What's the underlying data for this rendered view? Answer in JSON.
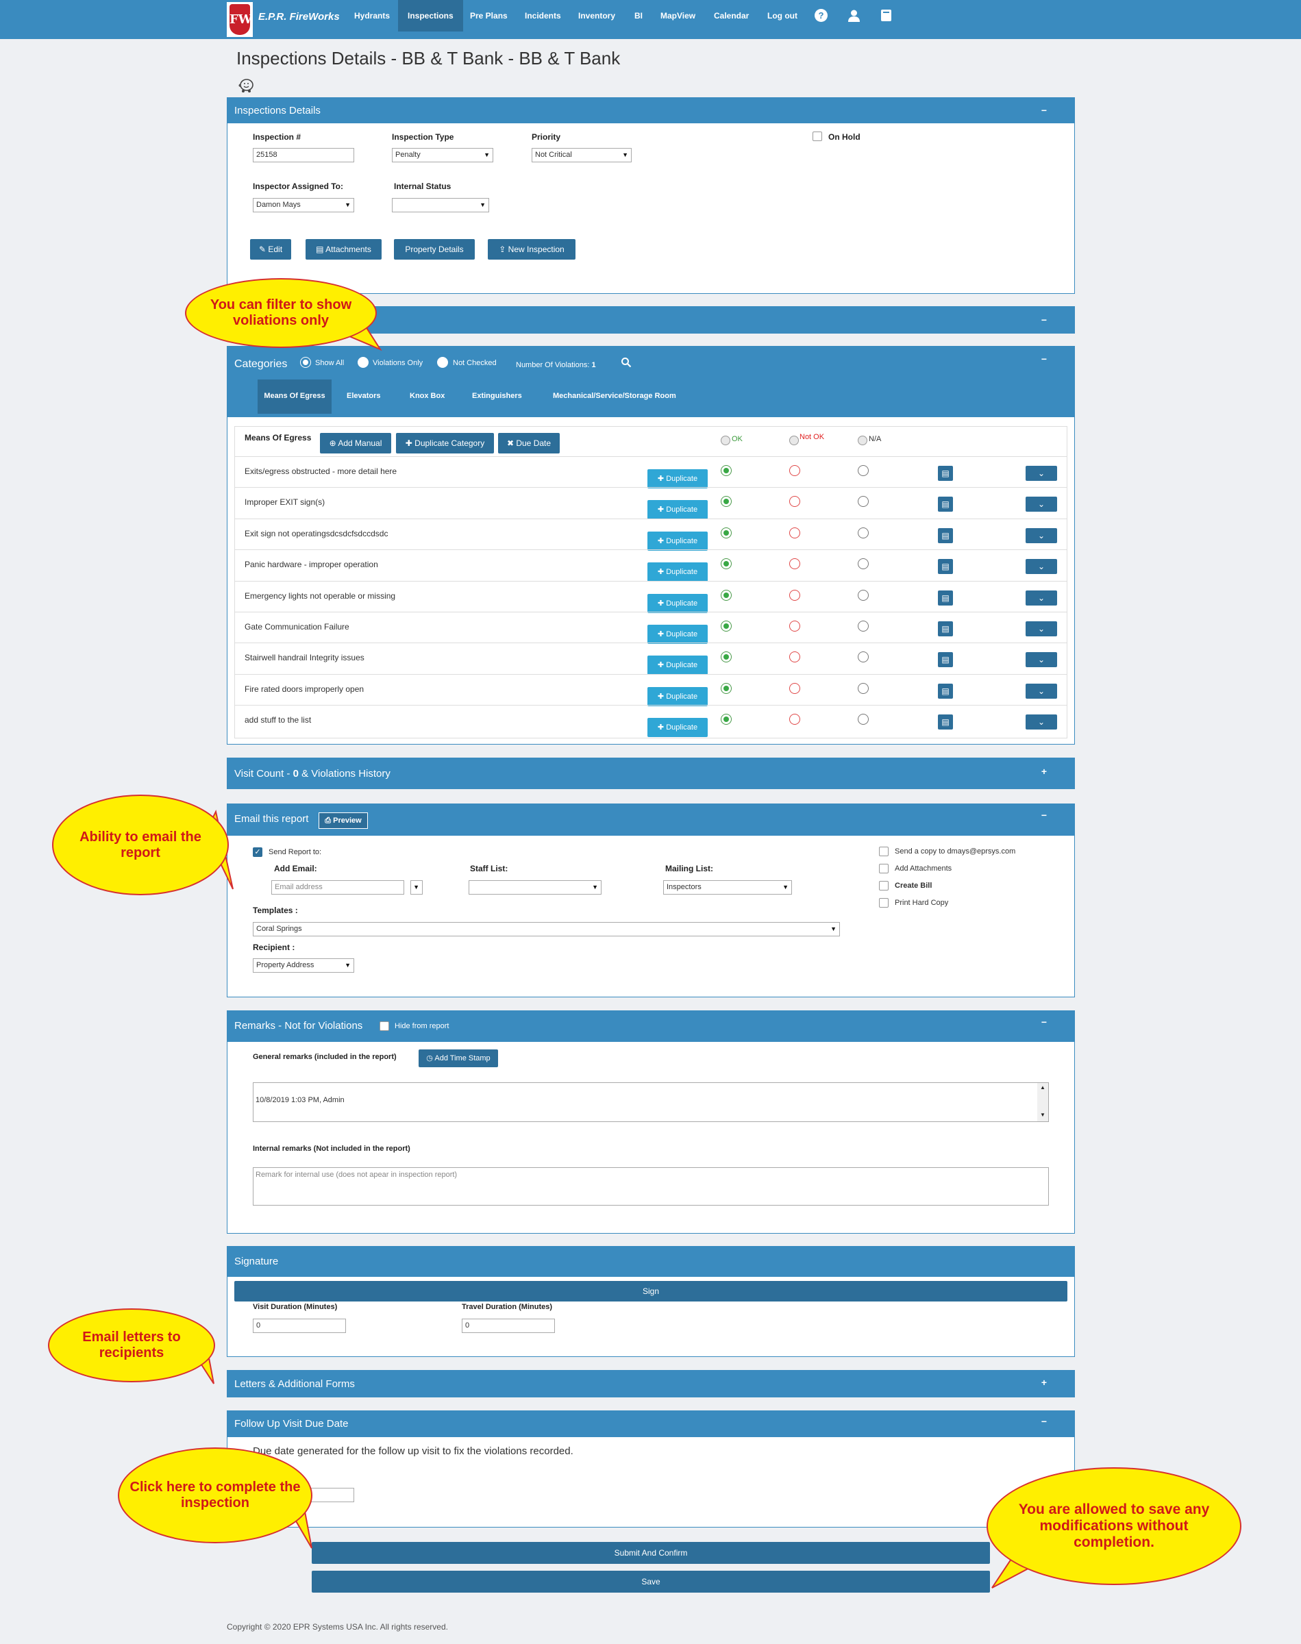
{
  "nav": {
    "brand": "E.P.R. FireWorks",
    "logo_letters": "FW",
    "items": [
      "Hydrants",
      "Inspections",
      "Pre Plans",
      "Incidents",
      "Inventory",
      "BI",
      "MapView",
      "Calendar",
      "Log out"
    ]
  },
  "page_title": "Inspections Details - BB & T Bank - BB & T Bank",
  "details": {
    "title": "Inspections Details",
    "inspection_label": "Inspection #",
    "inspection_value": "25158",
    "type_label": "Inspection Type",
    "type_value": "Penalty",
    "priority_label": "Priority",
    "priority_value": "Not Critical",
    "onhold_label": "On Hold",
    "inspector_label": "Inspector Assigned To:",
    "inspector_value": "Damon Mays",
    "status_label": "Internal Status",
    "buttons": [
      "Edit",
      "Attachments",
      "Property Details",
      "New Inspection"
    ]
  },
  "categories": {
    "title": "Categories",
    "filters": [
      "Show All",
      "Violations Only",
      "Not Checked"
    ],
    "violations_label": "Number Of Violations:",
    "violations_count": "1",
    "tabs": [
      "Means Of Egress",
      "Elevators",
      "Knox Box",
      "Extinguishers",
      "Mechanical/Service/Storage Room"
    ],
    "table_title": "Means Of Egress",
    "table_buttons": [
      "Add Manual",
      "Duplicate Category",
      "Due Date"
    ],
    "col_ok": "OK",
    "col_notok": "Not OK",
    "col_na": "N/A",
    "duplicate_label": "Duplicate",
    "rows": [
      "Exits/egress obstructed - more detail here",
      "Improper EXIT sign(s)",
      "Exit sign not operatingsdcsdcfsdccdsdc",
      "Panic hardware - improper operation",
      "Emergency lights not operable or missing",
      "Gate Communication Failure",
      "Stairwell handrail Integrity issues",
      "Fire rated doors improperly open",
      "add stuff to the list"
    ]
  },
  "visit": {
    "title_prefix": "Visit Count - ",
    "count": "0",
    "title_suffix": " & Violations History"
  },
  "email": {
    "title": "Email this report",
    "preview": "Preview",
    "send_to": "Send Report to:",
    "add_email": "Add Email:",
    "email_placeholder": "Email address",
    "staff_list": "Staff List:",
    "mailing_list": "Mailing List:",
    "mailing_value": "Inspectors",
    "templates_label": "Templates :",
    "templates_value": "Coral Springs",
    "recipient_label": "Recipient :",
    "recipient_value": "Property Address",
    "copy_to": "Send a copy to dmays@eprsys.com",
    "add_attachments": "Add Attachments",
    "create_bill": "Create Bill",
    "print_copy": "Print Hard Copy"
  },
  "remarks": {
    "title": "Remarks - Not for Violations",
    "hide": "Hide from report",
    "general_label": "General remarks (included in the report)",
    "timestamp_btn": "Add Time Stamp",
    "general_value": "10/8/2019 1:03 PM, Admin",
    "internal_label": "Internal remarks (Not included in the report)",
    "internal_placeholder": "Remark for internal use (does not apear in inspection report)"
  },
  "signature": {
    "title": "Signature",
    "sign": "Sign",
    "visit_label": "Visit Duration (Minutes)",
    "visit_value": "0",
    "travel_label": "Travel Duration (Minutes)",
    "travel_value": "0"
  },
  "letters": {
    "title": "Letters & Additional Forms"
  },
  "followup": {
    "title": "Follow Up Visit Due Date",
    "text": "Due date generated for the follow up visit to fix the violations recorded."
  },
  "actions": {
    "submit": "Submit And Confirm",
    "save": "Save"
  },
  "callouts": {
    "filter": "You can filter to show voliations only",
    "email": "Ability to email the report",
    "letters": "Email letters to recipients",
    "complete": "Click here to complete the inspection",
    "save": "You are allowed to save any modifications without completion."
  },
  "footer": "Copyright © 2020 EPR Systems USA Inc. All rights reserved.",
  "colors": {
    "primary": "#3a8bbf",
    "dark": "#2d6e99",
    "callout": "#ffef00",
    "callout_text": "#d01818"
  }
}
